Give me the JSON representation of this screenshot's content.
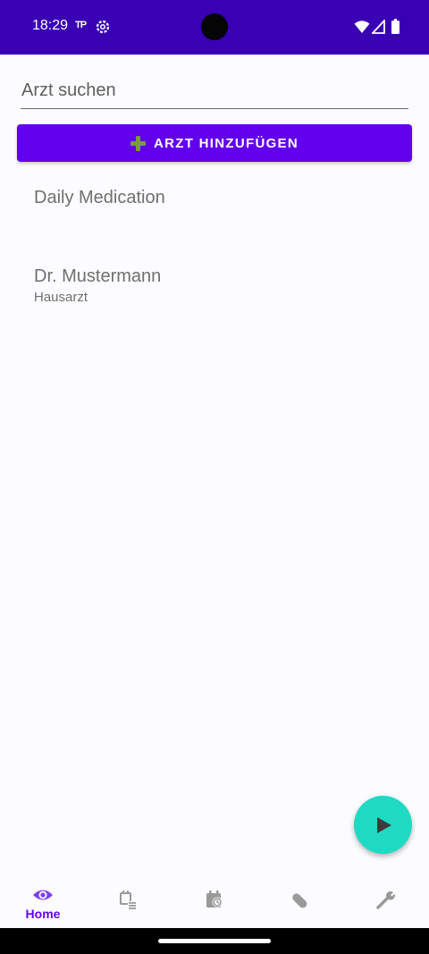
{
  "status_bar": {
    "time": "18:29",
    "indicator": "TP"
  },
  "search": {
    "value": "",
    "placeholder": "Arzt suchen"
  },
  "add_button": {
    "label": "ARZT HINZUFÜGEN",
    "icon": "plus-icon"
  },
  "list": {
    "items": [
      {
        "title": "Daily Medication",
        "subtitle": ""
      },
      {
        "title": "Dr. Mustermann",
        "subtitle": "Hausarzt"
      }
    ]
  },
  "fab": {
    "icon": "play-icon"
  },
  "bottom_nav": {
    "items": [
      {
        "icon": "eye-icon",
        "label": "Home",
        "selected": true
      },
      {
        "icon": "calendar-list-icon",
        "label": "",
        "selected": false
      },
      {
        "icon": "calendar-clock-icon",
        "label": "",
        "selected": false
      },
      {
        "icon": "pill-icon",
        "label": "",
        "selected": false
      },
      {
        "icon": "wrench-icon",
        "label": "",
        "selected": false
      }
    ]
  },
  "colors": {
    "status_bar": "#3a00b3",
    "primary": "#6200ee",
    "fab": "#1fdac3",
    "background": "#fcfbfe",
    "inactive_icon": "#9a9a9a"
  }
}
